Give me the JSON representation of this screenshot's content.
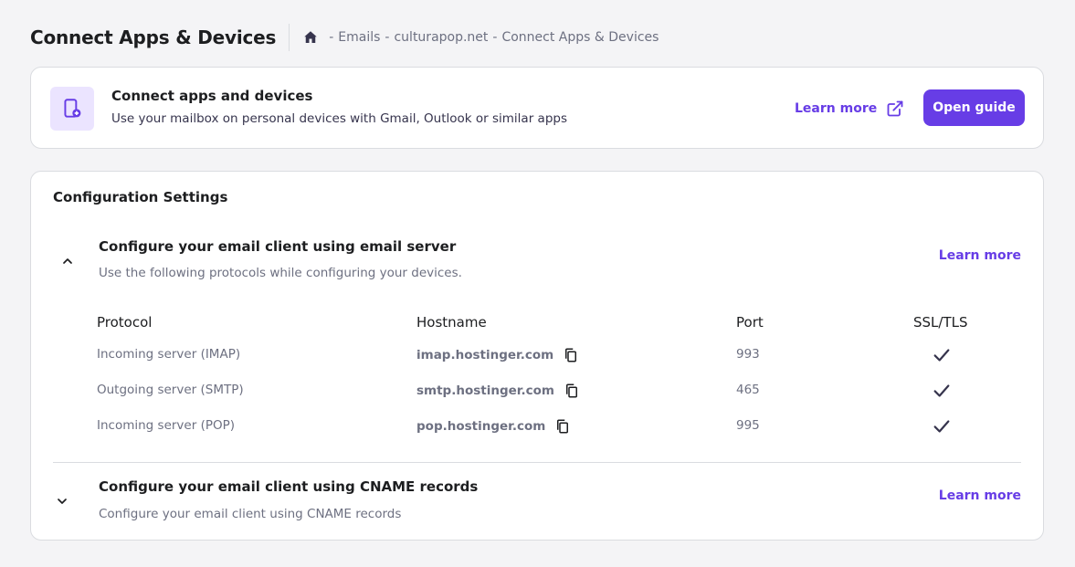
{
  "header": {
    "title": "Connect Apps & Devices",
    "breadcrumb": [
      "Emails",
      "culturapop.net",
      "Connect Apps & Devices"
    ]
  },
  "promo": {
    "icon": "device-add-icon",
    "title": "Connect apps and devices",
    "subtitle": "Use your mailbox on personal devices with Gmail, Outlook or similar apps",
    "learn_more": "Learn more",
    "open_guide": "Open guide"
  },
  "config": {
    "title": "Configuration Settings",
    "server_section": {
      "title": "Configure your email client using email server",
      "subtitle": "Use the following protocols while configuring your devices.",
      "learn_more": "Learn more",
      "expanded": true,
      "columns": [
        "Protocol",
        "Hostname",
        "Port",
        "SSL/TLS"
      ],
      "rows": [
        {
          "protocol": "Incoming server (IMAP)",
          "hostname": "imap.hostinger.com",
          "port": "993",
          "ssl": true
        },
        {
          "protocol": "Outgoing server (SMTP)",
          "hostname": "smtp.hostinger.com",
          "port": "465",
          "ssl": true
        },
        {
          "protocol": "Incoming server (POP)",
          "hostname": "pop.hostinger.com",
          "port": "995",
          "ssl": true
        }
      ]
    },
    "cname_section": {
      "title": "Configure your email client using CNAME records",
      "subtitle": "Configure your email client using CNAME records",
      "learn_more": "Learn more",
      "expanded": false
    }
  },
  "colors": {
    "accent": "#673de6",
    "accent_light": "#ebe4ff",
    "text_primary": "#1d1e20",
    "text_muted": "#6d7081",
    "background": "#f4f4f6"
  }
}
